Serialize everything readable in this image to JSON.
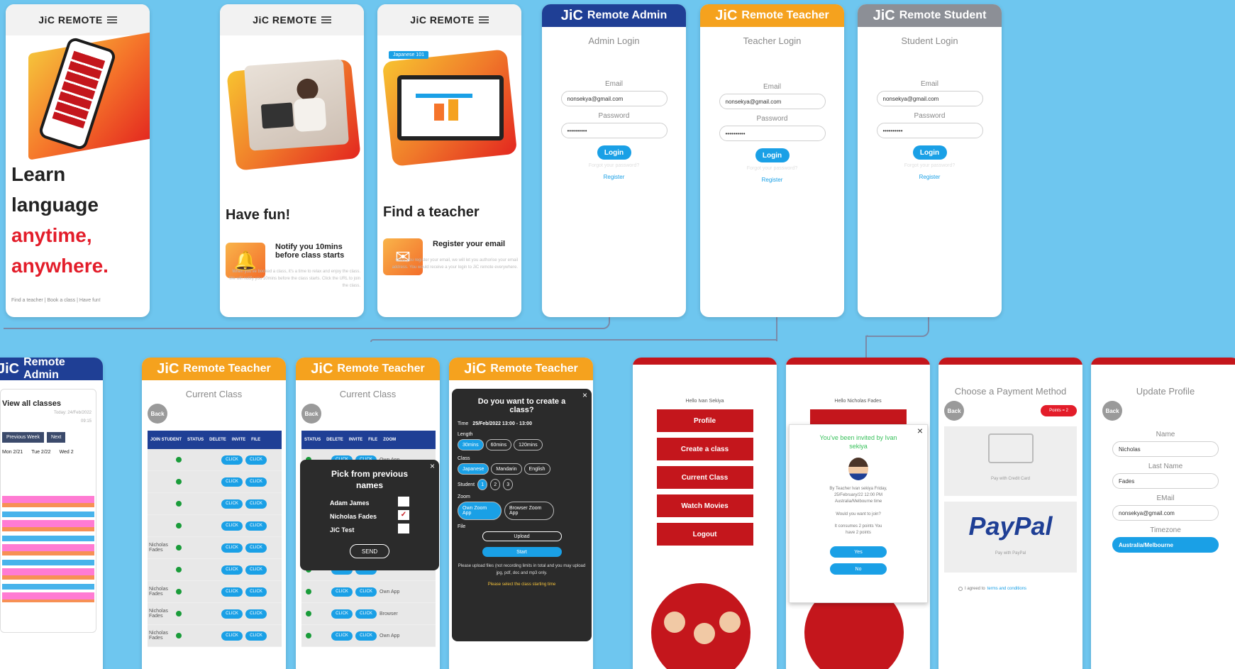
{
  "brand": {
    "mobile_title": "JiC REMOTE",
    "logo": "JiC",
    "admin": "Remote Admin",
    "teacher": "Remote Teacher",
    "student": "Remote Student"
  },
  "landing": {
    "line1": "Learn",
    "line2": "language",
    "line3": "anytime,",
    "line4": "anywhere.",
    "footer": "Find a teacher | Book a class | Have fun!"
  },
  "fun": {
    "title": "Have fun!",
    "feature_title": "Notify you 10mins before class starts",
    "body": "When you've booked a class, it's a time to relax and enjoy the class. We will notify you 10mins before the class starts. Click the URL to join the class."
  },
  "teacher_find": {
    "title": "Find a teacher",
    "feature_title": "Register your email",
    "body": "Once you register your email, we will let you authorise your email address. You would receive a your login to JiC remote everywhere.",
    "tag": "Japanese 101"
  },
  "login": {
    "admin_title": "Admin Login",
    "teacher_title": "Teacher Login",
    "student_title": "Student Login",
    "email_label": "Email",
    "password_label": "Password",
    "email_value": "nonsekya@gmail.com",
    "password_value": "••••••••••",
    "login_btn": "Login",
    "forgot": "Forgot your password?",
    "register": "Register"
  },
  "admin_classes": {
    "title": "View all classes",
    "today": "Today: 24/Feb/2022",
    "time": "09:15",
    "prev": "Previous Week",
    "next": "Next",
    "days": [
      "Mon 2/21",
      "Tue 2/22",
      "Wed 2"
    ]
  },
  "current_class": {
    "title": "Current Class",
    "back": "Back",
    "headers": [
      "JOIN STUDENT",
      "STATUS",
      "DELETE",
      "INVITE",
      "FILE"
    ],
    "headers2": [
      "STATUS",
      "DELETE",
      "INVITE",
      "FILE",
      "ZOOM"
    ],
    "click": "CLICK",
    "students": [
      "",
      "",
      "",
      "",
      "Nicholas Fades",
      "",
      "Nicholas Fades",
      "Nicholas Fades",
      "Nicholas Fades"
    ],
    "zoom": [
      "Own App",
      "",
      "",
      "",
      "Browser",
      "",
      "Own App",
      "Browser",
      "Own App"
    ]
  },
  "pick": {
    "title": "Pick from previous names",
    "names": [
      "Adam James",
      "Nicholas Fades",
      "JiC Test"
    ],
    "send": "SEND"
  },
  "create": {
    "title": "Do you want to create a class?",
    "time_label": "Time",
    "time_value": "25/Feb/2022 13:00 - 13:00",
    "length_label": "Length",
    "lengths": [
      "30mins",
      "60mins",
      "120mins"
    ],
    "class_label": "Class",
    "classes": [
      "Japanese",
      "Mandarin",
      "English"
    ],
    "student_label": "Student",
    "students": [
      "1",
      "2",
      "3"
    ],
    "zoom_label": "Zoom",
    "zooms": [
      "Own Zoom App",
      "Browser Zoom App"
    ],
    "file_label": "File",
    "upload": "Upload",
    "start": "Start",
    "note": "Please upload files (not recording limits in total and you may upload jpg, pdf, doc and mp3 only.",
    "warn": "Please select the class starting time"
  },
  "student_menu": {
    "hello": "Hello Ivan Sekiya",
    "items": [
      "Profile",
      "Create a class",
      "Current Class",
      "Watch Movies",
      "Logout"
    ]
  },
  "invite": {
    "hello": "Hello Nicholas Fades",
    "title": "You've been invited by Ivan sekiya",
    "details": "By Teacher Ivan sekiya Friday, 25/February/22 12:00 PM Australia/Melbourne time",
    "question": "Would you want to join?",
    "points": "It consumes 2 points You have 2 points",
    "yes": "Yes",
    "no": "No"
  },
  "payment": {
    "title": "Choose a Payment Method",
    "back": "Back",
    "points": "Points = 2",
    "credit": "Pay with Credit Card",
    "paypal": "PayPal",
    "paypal_sub": "Pay with PayPal",
    "agree": "I agreed to",
    "terms": "terms and conditions"
  },
  "profile": {
    "title": "Update Profile",
    "back": "Back",
    "name_label": "Name",
    "name": "Nicholas",
    "last_label": "Last Name",
    "last": "Fades",
    "email_label": "EMail",
    "email": "nonsekya@gmail.com",
    "tz_label": "Timezone",
    "tz": "Australia/Melbourne"
  },
  "colors": {
    "bg": "#6ec6ef",
    "admin": "#1f3f95",
    "teacher": "#f5a21e",
    "student": "#8c8f96",
    "red": "#c4161c",
    "blue": "#1aa0e6"
  }
}
